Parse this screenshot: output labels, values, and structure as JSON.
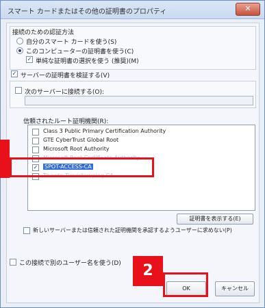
{
  "window": {
    "title": "スマート カードまたはその他の証明書のプロパティ",
    "close_glyph": "✕"
  },
  "auth": {
    "group_label": "接続のための認証方法",
    "option_smart_card": "自分のスマート カードを使う(S)",
    "option_certificate": "このコンピューターの証明書を使う(C)",
    "simple_selection": "単純な証明書の選択を使う (推奨)(M)"
  },
  "server": {
    "verify_label": "サーバーの証明書を検証する(V)",
    "connect_label": "次のサーバーに接続する(O):",
    "connect_value": ""
  },
  "roots": {
    "label": "信頼されたルート証明機関(R):",
    "items": [
      {
        "name": "Class 3 Public Primary Certification Authority",
        "checked": false
      },
      {
        "name": "GTE CyberTrust Global Root",
        "checked": false
      },
      {
        "name": "Microsoft Root Authority",
        "checked": false
      },
      {
        "name": "Microsoft Root Certificate Authority",
        "checked": false
      },
      {
        "name": "SPOT-ACCESS-CA",
        "checked": true
      },
      {
        "name": "Thawte Timestamping CA",
        "checked": false
      }
    ]
  },
  "view_cert_button": "証明書を表示する(E)",
  "no_prompt_label": "新しいサーバーまたは信頼された証明機関を承認するようユーザーに求めない(P)",
  "different_user_label": "この接続で別のユーザー名を使う(D)",
  "ok_button": "OK",
  "cancel_button": "キャンセル",
  "callouts": {
    "step_label": "2",
    "color": "#e8111b"
  },
  "colors": {
    "selection": "#2e6ce0",
    "titlebar": "#c9d9ef"
  }
}
